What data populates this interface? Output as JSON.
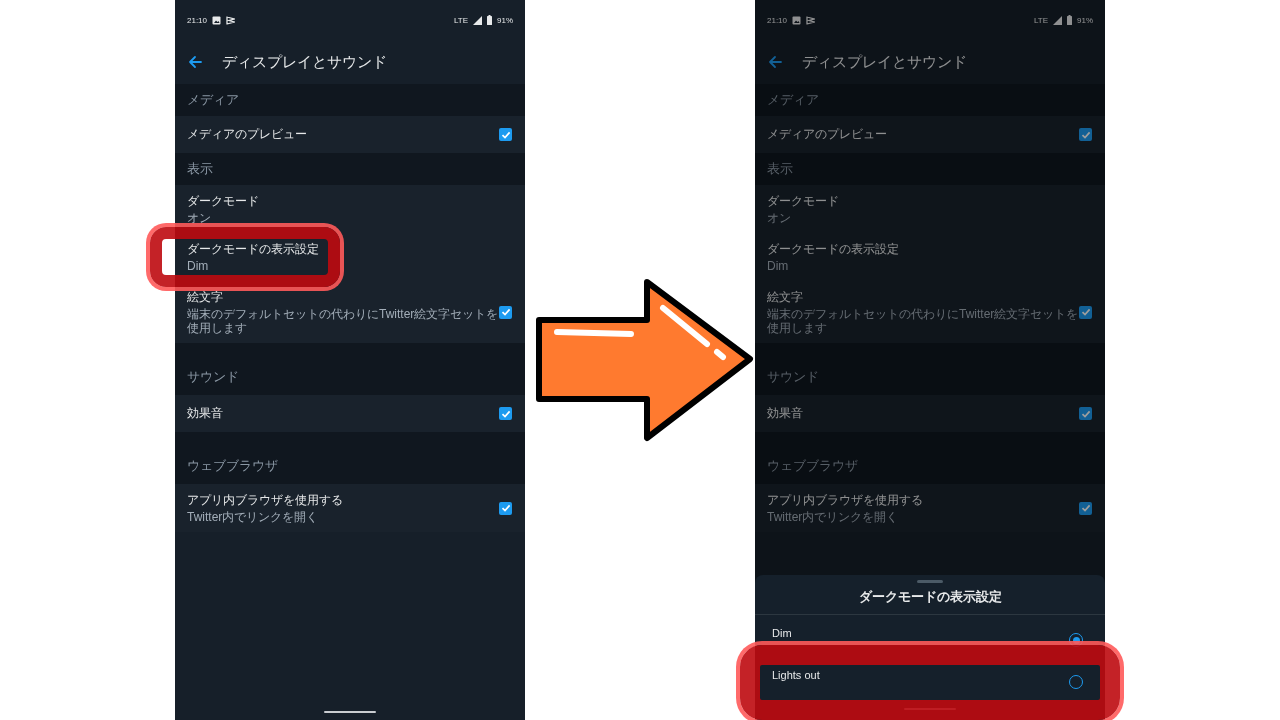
{
  "screens": [
    {
      "status_bar": {
        "time": "21:10",
        "network": "LTE",
        "battery": "91%"
      },
      "header": {
        "title": "ディスプレイとサウンド"
      },
      "sections": [
        {
          "title": "メディア",
          "items": [
            {
              "kind": "checkbox",
              "label": "メディアのプレビュー",
              "checked": true
            }
          ]
        },
        {
          "title": "表示",
          "items": [
            {
              "kind": "value",
              "label": "ダークモード",
              "value": "オン",
              "highlighted": false
            },
            {
              "kind": "value",
              "label": "ダークモードの表示設定",
              "value": "Dim",
              "highlighted": true
            },
            {
              "kind": "checkbox",
              "label": "絵文字",
              "description": "端末のデフォルトセットの代わりにTwitter絵文字セットを使用します",
              "checked": true
            }
          ]
        },
        {
          "title": "サウンド",
          "items": [
            {
              "kind": "checkbox",
              "label": "効果音",
              "checked": true
            }
          ]
        },
        {
          "title": "ウェブブラウザ",
          "items": [
            {
              "kind": "checkbox",
              "label": "アプリ内ブラウザを使用する",
              "description": "Twitter内でリンクを開く",
              "checked": true
            }
          ]
        }
      ]
    },
    {
      "dimmed": true,
      "status_bar": {
        "time": "21:10",
        "network": "LTE",
        "battery": "91%"
      },
      "header": {
        "title": "ディスプレイとサウンド"
      },
      "sections": [
        {
          "title": "メディア",
          "items": [
            {
              "kind": "checkbox",
              "label": "メディアのプレビュー",
              "checked": true
            }
          ]
        },
        {
          "title": "表示",
          "items": [
            {
              "kind": "value",
              "label": "ダークモード",
              "value": "オン",
              "highlighted": false
            },
            {
              "kind": "value",
              "label": "ダークモードの表示設定",
              "value": "Dim",
              "highlighted": false
            },
            {
              "kind": "checkbox",
              "label": "絵文字",
              "description": "端末のデフォルトセットの代わりにTwitter絵文字セットを使用します",
              "checked": true
            }
          ]
        },
        {
          "title": "サウンド",
          "items": [
            {
              "kind": "checkbox",
              "label": "効果音",
              "checked": true
            }
          ]
        },
        {
          "title": "ウェブブラウザ",
          "items": [
            {
              "kind": "checkbox",
              "label": "アプリ内ブラウザを使用する",
              "description": "Twitter内でリンクを開く",
              "checked": true
            }
          ]
        }
      ],
      "sheet": {
        "title": "ダークモードの表示設定",
        "options": [
          {
            "label": "Dim",
            "selected": true,
            "highlighted": false
          },
          {
            "label": "Lights out",
            "selected": false,
            "highlighted": true
          }
        ]
      }
    }
  ]
}
